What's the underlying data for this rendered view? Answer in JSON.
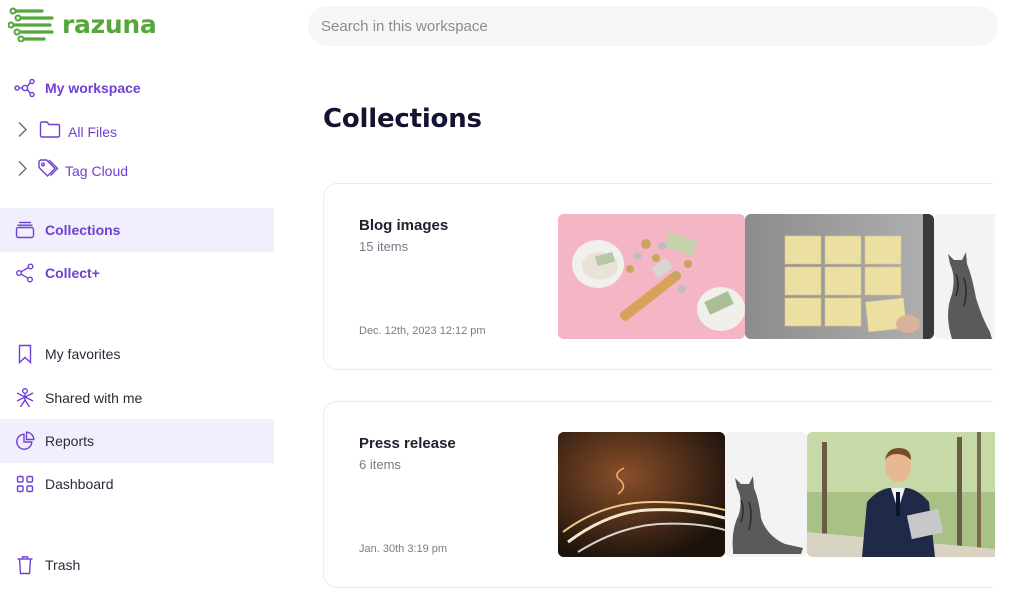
{
  "app": {
    "name": "razuna",
    "brand_color": "#55a63c",
    "accent_color": "#6f3fd6"
  },
  "search": {
    "placeholder": "Search in this workspace"
  },
  "sidebar": {
    "workspace": {
      "label": "My workspace",
      "icon": "workspace-network-icon"
    },
    "tree": [
      {
        "label": "All Files",
        "icon": "folder-icon",
        "expanded": false
      },
      {
        "label": "Tag Cloud",
        "icon": "tag-icon",
        "expanded": false
      }
    ],
    "items": [
      {
        "label": "Collections",
        "icon": "collections-icon",
        "active": true
      },
      {
        "label": "Collect+",
        "icon": "share-nodes-icon",
        "active": false
      },
      {
        "label": "My favorites",
        "icon": "bookmark-icon",
        "active": false
      },
      {
        "label": "Shared with me",
        "icon": "shared-person-icon",
        "active": false
      },
      {
        "label": "Reports",
        "icon": "pie-chart-icon",
        "active": false,
        "highlighted": true
      },
      {
        "label": "Dashboard",
        "icon": "grid-icon",
        "active": false
      },
      {
        "label": "Trash",
        "icon": "trash-icon",
        "active": false
      }
    ]
  },
  "main": {
    "title": "Collections",
    "collections": [
      {
        "name": "Blog images",
        "count": "15 items",
        "date": "Dec. 12th, 2023 12:12 pm",
        "thumbnails": [
          "coins-piggy-bank-pink",
          "sticky-notes-grey",
          "cat-sitting-bw"
        ]
      },
      {
        "name": "Press release",
        "count": "6 items",
        "date": "Jan. 30th 3:19 pm",
        "thumbnails": [
          "light-trails-tunnel",
          "cat-sitting-bw",
          "businessman-park"
        ]
      }
    ]
  }
}
